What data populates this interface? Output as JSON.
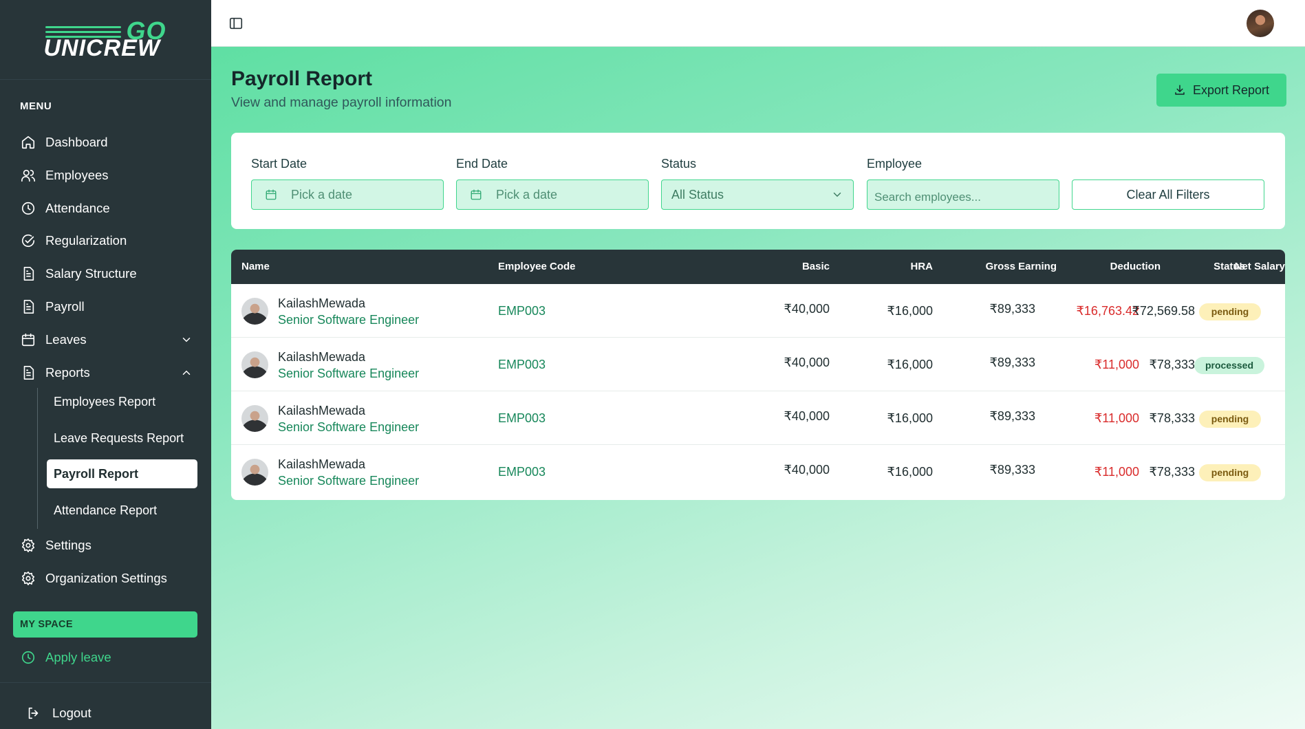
{
  "brand": {
    "logo_top": "GO",
    "logo_bottom": "UNICREW"
  },
  "sidebar": {
    "menu_title": "MENU",
    "items": [
      {
        "label": "Dashboard",
        "icon": "home-icon"
      },
      {
        "label": "Employees",
        "icon": "users-icon"
      },
      {
        "label": "Attendance",
        "icon": "clock-icon"
      },
      {
        "label": "Regularization",
        "icon": "check-circle-icon"
      },
      {
        "label": "Salary Structure",
        "icon": "document-icon"
      },
      {
        "label": "Payroll",
        "icon": "document-icon"
      },
      {
        "label": "Leaves",
        "icon": "calendar-icon"
      },
      {
        "label": "Reports",
        "icon": "document-icon"
      },
      {
        "label": "Settings",
        "icon": "gear-icon"
      },
      {
        "label": "Organization Settings",
        "icon": "gear-icon"
      }
    ],
    "reports_sub": [
      {
        "label": "Employees Report"
      },
      {
        "label": "Leave Requests Report"
      },
      {
        "label": "Payroll Report"
      },
      {
        "label": "Attendance Report"
      }
    ],
    "my_space": "MY SPACE",
    "apply_leave": "Apply leave",
    "logout": "Logout"
  },
  "page": {
    "title": "Payroll Report",
    "subtitle": "View and manage payroll information",
    "export_label": "Export Report"
  },
  "filters": {
    "start_label": "Start Date",
    "start_placeholder": "Pick a date",
    "end_label": "End Date",
    "end_placeholder": "Pick a date",
    "status_label": "Status",
    "status_value": "All Status",
    "employee_label": "Employee",
    "employee_placeholder": "Search employees...",
    "clear_label": "Clear All Filters"
  },
  "table": {
    "headers": [
      "Name",
      "Employee Code",
      "Basic",
      "HRA",
      "Gross Earning",
      "Deduction",
      "Net Salary",
      "Status"
    ],
    "rows": [
      {
        "name": "KailashMewada",
        "role": "Senior Software Engineer",
        "code": "EMP003",
        "basic": "₹40,000",
        "hra": "₹16,000",
        "gross": "₹89,333",
        "deduction": "₹16,763.42",
        "net": "₹72,569.58",
        "status": "pending"
      },
      {
        "name": "KailashMewada",
        "role": "Senior Software Engineer",
        "code": "EMP003",
        "basic": "₹40,000",
        "hra": "₹16,000",
        "gross": "₹89,333",
        "deduction": "₹11,000",
        "net": "₹78,333",
        "status": "processed"
      },
      {
        "name": "KailashMewada",
        "role": "Senior Software Engineer",
        "code": "EMP003",
        "basic": "₹40,000",
        "hra": "₹16,000",
        "gross": "₹89,333",
        "deduction": "₹11,000",
        "net": "₹78,333",
        "status": "pending"
      },
      {
        "name": "KailashMewada",
        "role": "Senior Software Engineer",
        "code": "EMP003",
        "basic": "₹40,000",
        "hra": "₹16,000",
        "gross": "₹89,333",
        "deduction": "₹11,000",
        "net": "₹78,333",
        "status": "pending"
      }
    ]
  },
  "colors": {
    "sidebar": "#283539",
    "accent": "#3fd68c",
    "deduction": "#d92b2b"
  }
}
